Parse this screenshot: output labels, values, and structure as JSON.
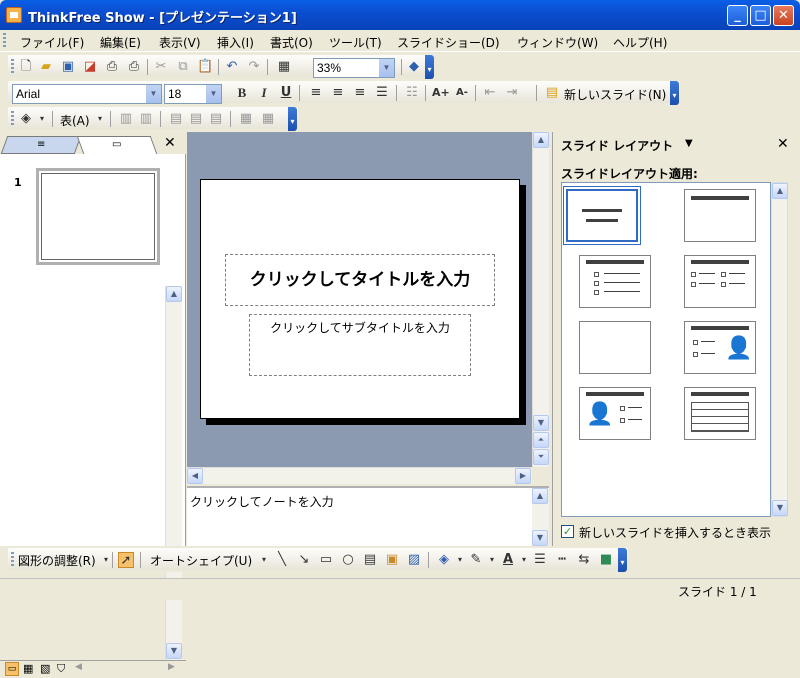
{
  "window": {
    "title": "ThinkFree Show - [プレゼンテーション1]",
    "min": "_",
    "max": "□",
    "close": "✕"
  },
  "menu": [
    "ファイル(F)",
    "編集(E)",
    "表示(V)",
    "挿入(I)",
    "書式(O)",
    "ツール(T)",
    "スライドショー(D)",
    "ウィンドウ(W)",
    "ヘルプ(H)"
  ],
  "toolbar": {
    "zoom": "33%",
    "font": "Arial",
    "size": "18",
    "bold": "B",
    "italic": "I",
    "underline": "U",
    "font_grow": "A+",
    "font_shrink": "A-",
    "new_slide": "新しいスライド(N)",
    "table_menu": "表(A)"
  },
  "left_pane": {
    "slide_number": "1"
  },
  "slide": {
    "title_placeholder": "クリックしてタイトルを入力",
    "subtitle_placeholder": "クリックしてサブタイトルを入力"
  },
  "notes": {
    "placeholder": "クリックしてノートを入力"
  },
  "task_pane": {
    "title": "スライド レイアウト",
    "subtitle": "スライドレイアウト適用:",
    "checkbox_label": "新しいスライドを挿入するとき表示",
    "checked": true
  },
  "drawing": {
    "adjust": "図形の調整(R)",
    "autoshape": "オートシェイプ(U)"
  },
  "status": {
    "slide": "スライド 1 / 1"
  },
  "colors": {
    "title_bar": "#0842B8",
    "canvas_bg": "#8C9AB1",
    "selection": "#316AC5"
  }
}
